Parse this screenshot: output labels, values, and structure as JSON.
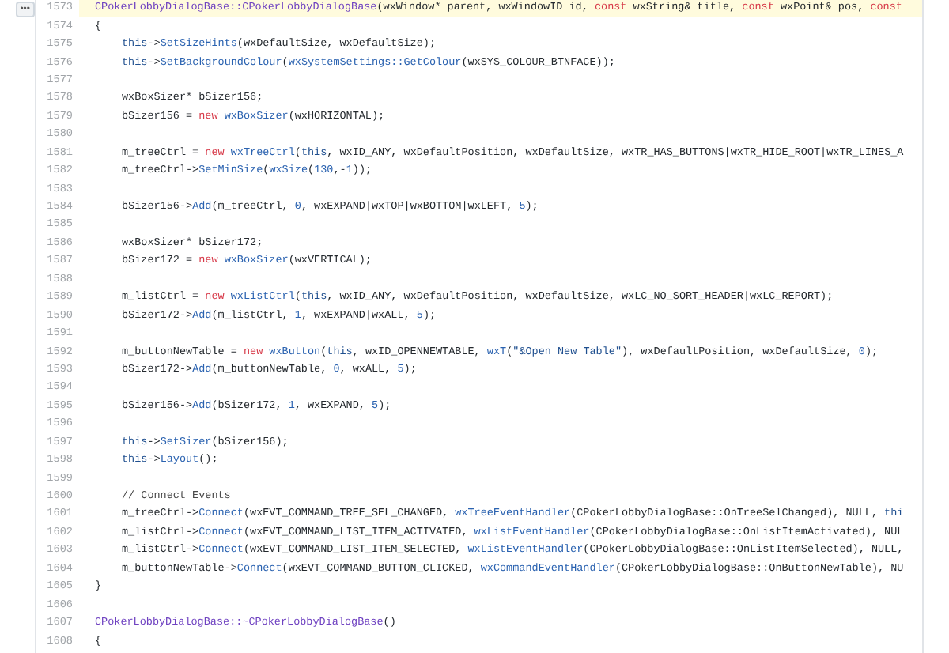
{
  "expand_button": "•••",
  "lines": [
    {
      "number": "1573",
      "highlighted": true,
      "tokens": [
        {
          "text": "CPokerLobbyDialogBase::CPokerLobbyDialogBase",
          "kind": "class"
        },
        {
          "text": "(wxWindow* parent, wxWindowID id, ",
          "kind": "plain"
        },
        {
          "text": "const",
          "kind": "keyword"
        },
        {
          "text": " wxString& title, ",
          "kind": "plain"
        },
        {
          "text": "const",
          "kind": "keyword"
        },
        {
          "text": " wxPoint& pos, ",
          "kind": "plain"
        },
        {
          "text": "const",
          "kind": "keyword"
        }
      ]
    },
    {
      "number": "1574",
      "highlighted": false,
      "tokens": [
        {
          "text": "{",
          "kind": "plain"
        }
      ],
      "children": [
        {
          "number": "1575",
          "highlighted": false,
          "tokens": [
            {
              "text": "this",
              "kind": "self"
            },
            {
              "text": "->",
              "kind": "plain"
            },
            {
              "text": "SetSizeHints",
              "kind": "call"
            },
            {
              "text": "(wxDefaultSize, wxDefaultSize);",
              "kind": "plain"
            }
          ]
        },
        {
          "number": "1576",
          "highlighted": false,
          "tokens": [
            {
              "text": "this",
              "kind": "self"
            },
            {
              "text": "->",
              "kind": "plain"
            },
            {
              "text": "SetBackgroundColour",
              "kind": "call"
            },
            {
              "text": "(",
              "kind": "plain"
            },
            {
              "text": "wxSystemSettings::GetColour",
              "kind": "call"
            },
            {
              "text": "(wxSYS_COLOUR_BTNFACE));",
              "kind": "plain"
            }
          ]
        },
        {
          "number": "1577"
        },
        {
          "number": "1578",
          "highlighted": false,
          "tokens": [
            {
              "text": "wxBoxSizer* bSizer156;",
              "kind": "plain"
            }
          ]
        },
        {
          "number": "1579",
          "highlighted": false,
          "tokens": [
            {
              "text": "bSizer156 = ",
              "kind": "plain"
            },
            {
              "text": "new ",
              "kind": "keyword"
            },
            {
              "text": "wxBoxSizer",
              "kind": "call"
            },
            {
              "text": "(wxHORIZONTAL);",
              "kind": "plain"
            }
          ]
        },
        {
          "number": "1580"
        },
        {
          "number": "1581",
          "highlighted": false,
          "tokens": [
            {
              "text": "m_treeCtrl = ",
              "kind": "plain"
            },
            {
              "text": "new ",
              "kind": "keyword"
            },
            {
              "text": "wxTreeCtrl",
              "kind": "call"
            },
            {
              "text": "(",
              "kind": "plain"
            },
            {
              "text": "this",
              "kind": "self"
            },
            {
              "text": ", wxID_ANY, wxDefaultPosition, wxDefaultSize, wxTR_HAS_BUTTONS|wxTR_HIDE_ROOT|wxTR_LINES_A",
              "kind": "plain"
            }
          ]
        },
        {
          "number": "1582",
          "highlighted": false,
          "tokens": [
            {
              "text": "m_treeCtrl->",
              "kind": "plain"
            },
            {
              "text": "SetMinSize",
              "kind": "call"
            },
            {
              "text": "(",
              "kind": "plain"
            },
            {
              "text": "wxSize",
              "kind": "call"
            },
            {
              "text": "(",
              "kind": "plain"
            },
            {
              "text": "130",
              "kind": "number"
            },
            {
              "text": ",-",
              "kind": "plain"
            },
            {
              "text": "1",
              "kind": "number"
            },
            {
              "text": "));",
              "kind": "plain"
            }
          ]
        },
        {
          "number": "1583"
        },
        {
          "number": "1584",
          "highlighted": false,
          "tokens": [
            {
              "text": "bSizer156->",
              "kind": "plain"
            },
            {
              "text": "Add",
              "kind": "call"
            },
            {
              "text": "(m_treeCtrl, ",
              "kind": "plain"
            },
            {
              "text": "0",
              "kind": "number"
            },
            {
              "text": ", wxEXPAND|wxTOP|wxBOTTOM|wxLEFT, ",
              "kind": "plain"
            },
            {
              "text": "5",
              "kind": "number"
            },
            {
              "text": ");",
              "kind": "plain"
            }
          ]
        },
        {
          "number": "1585"
        },
        {
          "number": "1586",
          "highlighted": false,
          "tokens": [
            {
              "text": "wxBoxSizer* bSizer172;",
              "kind": "plain"
            }
          ]
        },
        {
          "number": "1587",
          "highlighted": false,
          "tokens": [
            {
              "text": "bSizer172 = ",
              "kind": "plain"
            },
            {
              "text": "new ",
              "kind": "keyword"
            },
            {
              "text": "wxBoxSizer",
              "kind": "call"
            },
            {
              "text": "(wxVERTICAL);",
              "kind": "plain"
            }
          ]
        },
        {
          "number": "1588"
        },
        {
          "number": "1589",
          "highlighted": false,
          "tokens": [
            {
              "text": "m_listCtrl = ",
              "kind": "plain"
            },
            {
              "text": "new ",
              "kind": "keyword"
            },
            {
              "text": "wxListCtrl",
              "kind": "call"
            },
            {
              "text": "(",
              "kind": "plain"
            },
            {
              "text": "this",
              "kind": "self"
            },
            {
              "text": ", wxID_ANY, wxDefaultPosition, wxDefaultSize, wxLC_NO_SORT_HEADER|wxLC_REPORT);",
              "kind": "plain"
            }
          ]
        },
        {
          "number": "1590",
          "highlighted": false,
          "tokens": [
            {
              "text": "bSizer172->",
              "kind": "plain"
            },
            {
              "text": "Add",
              "kind": "call"
            },
            {
              "text": "(m_listCtrl, ",
              "kind": "plain"
            },
            {
              "text": "1",
              "kind": "number"
            },
            {
              "text": ", wxEXPAND|wxALL, ",
              "kind": "plain"
            },
            {
              "text": "5",
              "kind": "number"
            },
            {
              "text": ");",
              "kind": "plain"
            }
          ]
        },
        {
          "number": "1591"
        },
        {
          "number": "1592",
          "highlighted": false,
          "tokens": [
            {
              "text": "m_buttonNewTable = ",
              "kind": "plain"
            },
            {
              "text": "new ",
              "kind": "keyword"
            },
            {
              "text": "wxButton",
              "kind": "call"
            },
            {
              "text": "(",
              "kind": "plain"
            },
            {
              "text": "this",
              "kind": "self"
            },
            {
              "text": ", wxID_OPENNEWTABLE, ",
              "kind": "plain"
            },
            {
              "text": "wxT",
              "kind": "call"
            },
            {
              "text": "(",
              "kind": "plain"
            },
            {
              "text": "\"&Open New Table\"",
              "kind": "string"
            },
            {
              "text": "), wxDefaultPosition, wxDefaultSize, ",
              "kind": "plain"
            },
            {
              "text": "0",
              "kind": "number"
            },
            {
              "text": ");",
              "kind": "plain"
            }
          ]
        },
        {
          "number": "1593",
          "highlighted": false,
          "tokens": [
            {
              "text": "bSizer172->",
              "kind": "plain"
            },
            {
              "text": "Add",
              "kind": "call"
            },
            {
              "text": "(m_buttonNewTable, ",
              "kind": "plain"
            },
            {
              "text": "0",
              "kind": "number"
            },
            {
              "text": ", wxALL, ",
              "kind": "plain"
            },
            {
              "text": "5",
              "kind": "number"
            },
            {
              "text": ");",
              "kind": "plain"
            }
          ]
        },
        {
          "number": "1594"
        },
        {
          "number": "1595",
          "highlighted": false,
          "tokens": [
            {
              "text": "bSizer156->",
              "kind": "plain"
            },
            {
              "text": "Add",
              "kind": "call"
            },
            {
              "text": "(bSizer172, ",
              "kind": "plain"
            },
            {
              "text": "1",
              "kind": "number"
            },
            {
              "text": ", wxEXPAND, ",
              "kind": "plain"
            },
            {
              "text": "5",
              "kind": "number"
            },
            {
              "text": ");",
              "kind": "plain"
            }
          ]
        },
        {
          "number": "1596"
        },
        {
          "number": "1597",
          "highlighted": false,
          "tokens": [
            {
              "text": "this",
              "kind": "self"
            },
            {
              "text": "->",
              "kind": "plain"
            },
            {
              "text": "SetSizer",
              "kind": "call"
            },
            {
              "text": "(bSizer156);",
              "kind": "plain"
            }
          ]
        },
        {
          "number": "1598",
          "highlighted": false,
          "tokens": [
            {
              "text": "this",
              "kind": "self"
            },
            {
              "text": "->",
              "kind": "plain"
            },
            {
              "text": "Layout",
              "kind": "call"
            },
            {
              "text": "();",
              "kind": "plain"
            }
          ]
        },
        {
          "number": "1599"
        },
        {
          "number": "1600",
          "highlighted": false,
          "tokens": [
            {
              "text": "// Connect Events",
              "kind": "comment"
            }
          ]
        },
        {
          "number": "1601",
          "highlighted": false,
          "tokens": [
            {
              "text": "m_treeCtrl->",
              "kind": "plain"
            },
            {
              "text": "Connect",
              "kind": "call"
            },
            {
              "text": "(wxEVT_COMMAND_TREE_SEL_CHANGED, ",
              "kind": "plain"
            },
            {
              "text": "wxTreeEventHandler",
              "kind": "call"
            },
            {
              "text": "(CPokerLobbyDialogBase::OnTreeSelChanged), NULL, ",
              "kind": "plain"
            },
            {
              "text": "thi",
              "kind": "self"
            }
          ]
        },
        {
          "number": "1602",
          "highlighted": false,
          "tokens": [
            {
              "text": "m_listCtrl->",
              "kind": "plain"
            },
            {
              "text": "Connect",
              "kind": "call"
            },
            {
              "text": "(wxEVT_COMMAND_LIST_ITEM_ACTIVATED, ",
              "kind": "plain"
            },
            {
              "text": "wxListEventHandler",
              "kind": "call"
            },
            {
              "text": "(CPokerLobbyDialogBase::OnListItemActivated), NUL",
              "kind": "plain"
            }
          ]
        },
        {
          "number": "1603",
          "highlighted": false,
          "tokens": [
            {
              "text": "m_listCtrl->",
              "kind": "plain"
            },
            {
              "text": "Connect",
              "kind": "call"
            },
            {
              "text": "(wxEVT_COMMAND_LIST_ITEM_SELECTED, ",
              "kind": "plain"
            },
            {
              "text": "wxListEventHandler",
              "kind": "call"
            },
            {
              "text": "(CPokerLobbyDialogBase::OnListItemSelected), NULL,",
              "kind": "plain"
            }
          ]
        },
        {
          "number": "1604",
          "highlighted": false,
          "tokens": [
            {
              "text": "m_buttonNewTable->",
              "kind": "plain"
            },
            {
              "text": "Connect",
              "kind": "call"
            },
            {
              "text": "(wxEVT_COMMAND_BUTTON_CLICKED, ",
              "kind": "plain"
            },
            {
              "text": "wxCommandEventHandler",
              "kind": "call"
            },
            {
              "text": "(CPokerLobbyDialogBase::OnButtonNewTable), NU",
              "kind": "plain"
            }
          ]
        }
      ]
    },
    {
      "number": "1605",
      "highlighted": false,
      "tokens": [
        {
          "text": "}",
          "kind": "plain"
        }
      ]
    },
    {
      "number": "1606"
    },
    {
      "number": "1607",
      "highlighted": false,
      "tokens": [
        {
          "text": "CPokerLobbyDialogBase::~CPokerLobbyDialogBase",
          "kind": "class"
        },
        {
          "text": "()",
          "kind": "plain"
        }
      ]
    },
    {
      "number": "1608",
      "highlighted": false,
      "tokens": [
        {
          "text": "{",
          "kind": "plain"
        }
      ]
    }
  ]
}
